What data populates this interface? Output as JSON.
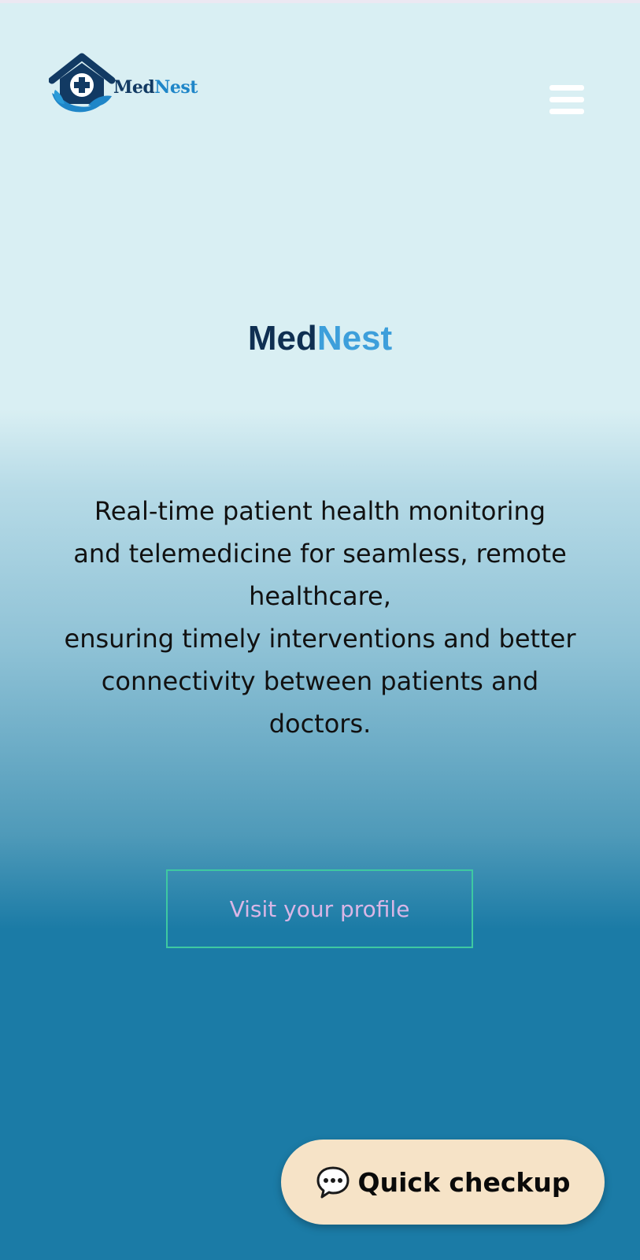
{
  "header": {
    "logo": {
      "text_part1": "Med",
      "text_part2": "Nest",
      "icon": "house-cross-hand-icon"
    },
    "menu_icon": "hamburger-menu-icon"
  },
  "hero": {
    "title_part1": "Med",
    "title_part2": "Nest",
    "tagline_lines": [
      "Real-time patient health monitoring",
      "and telemedicine for seamless, remote",
      "healthcare,",
      "ensuring timely interventions and better",
      "connectivity between patients and",
      "doctors."
    ]
  },
  "profile_button": {
    "label": "Visit your profile"
  },
  "quick_checkup": {
    "icon": "speech-bubble-icon",
    "label": "Quick checkup"
  },
  "colors": {
    "brand_dark": "#123a63",
    "brand_light": "#3d9fdb",
    "profile_border": "#3ec9a1",
    "profile_text": "#d9b6e6",
    "quick_bg": "#f6e3c7"
  }
}
